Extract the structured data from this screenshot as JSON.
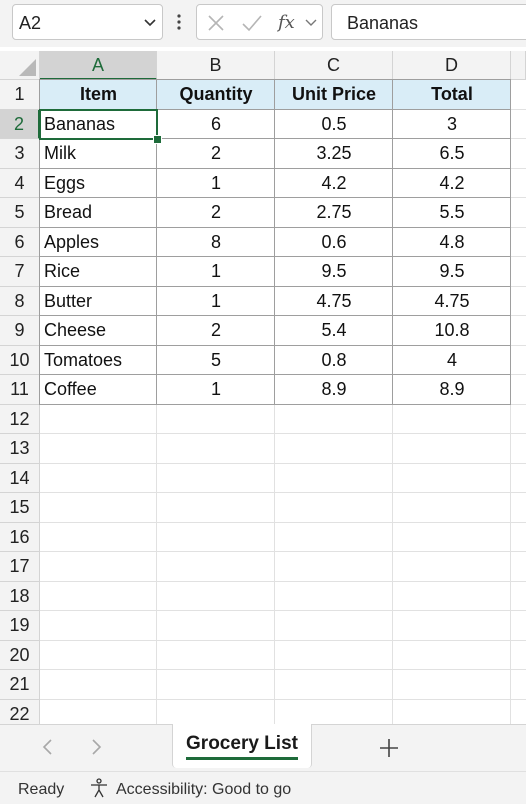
{
  "formula_bar": {
    "name_box": "A2",
    "formula": "Bananas",
    "icons": [
      "chevron-down-icon",
      "more-vertical-icon",
      "cancel-x-icon",
      "enter-check-icon",
      "function-fx-icon"
    ]
  },
  "columns": [
    "A",
    "B",
    "C",
    "D"
  ],
  "row_numbers": [
    "1",
    "2",
    "3",
    "4",
    "5",
    "6",
    "7",
    "8",
    "9",
    "10",
    "11",
    "12",
    "13",
    "14",
    "15",
    "16",
    "17",
    "18",
    "19",
    "20",
    "21",
    "22"
  ],
  "table": {
    "headers": [
      "Item",
      "Quantity",
      "Unit Price",
      "Total"
    ],
    "rows": [
      [
        "Bananas",
        "6",
        "0.5",
        "3"
      ],
      [
        "Milk",
        "2",
        "3.25",
        "6.5"
      ],
      [
        "Eggs",
        "1",
        "4.2",
        "4.2"
      ],
      [
        "Bread",
        "2",
        "2.75",
        "5.5"
      ],
      [
        "Apples",
        "8",
        "0.6",
        "4.8"
      ],
      [
        "Rice",
        "1",
        "9.5",
        "9.5"
      ],
      [
        "Butter",
        "1",
        "4.75",
        "4.75"
      ],
      [
        "Cheese",
        "2",
        "5.4",
        "10.8"
      ],
      [
        "Tomatoes",
        "5",
        "0.8",
        "4"
      ],
      [
        "Coffee",
        "1",
        "8.9",
        "8.9"
      ]
    ]
  },
  "selection": {
    "column": "A",
    "row": "2"
  },
  "sheets": {
    "active": "Grocery List"
  },
  "status_bar": {
    "ready": "Ready",
    "accessibility": "Accessibility: Good to go"
  },
  "colors": {
    "accent": "#1e6b3a",
    "header_fill": "#d9edf7",
    "chrome": "#f3f3f3"
  }
}
